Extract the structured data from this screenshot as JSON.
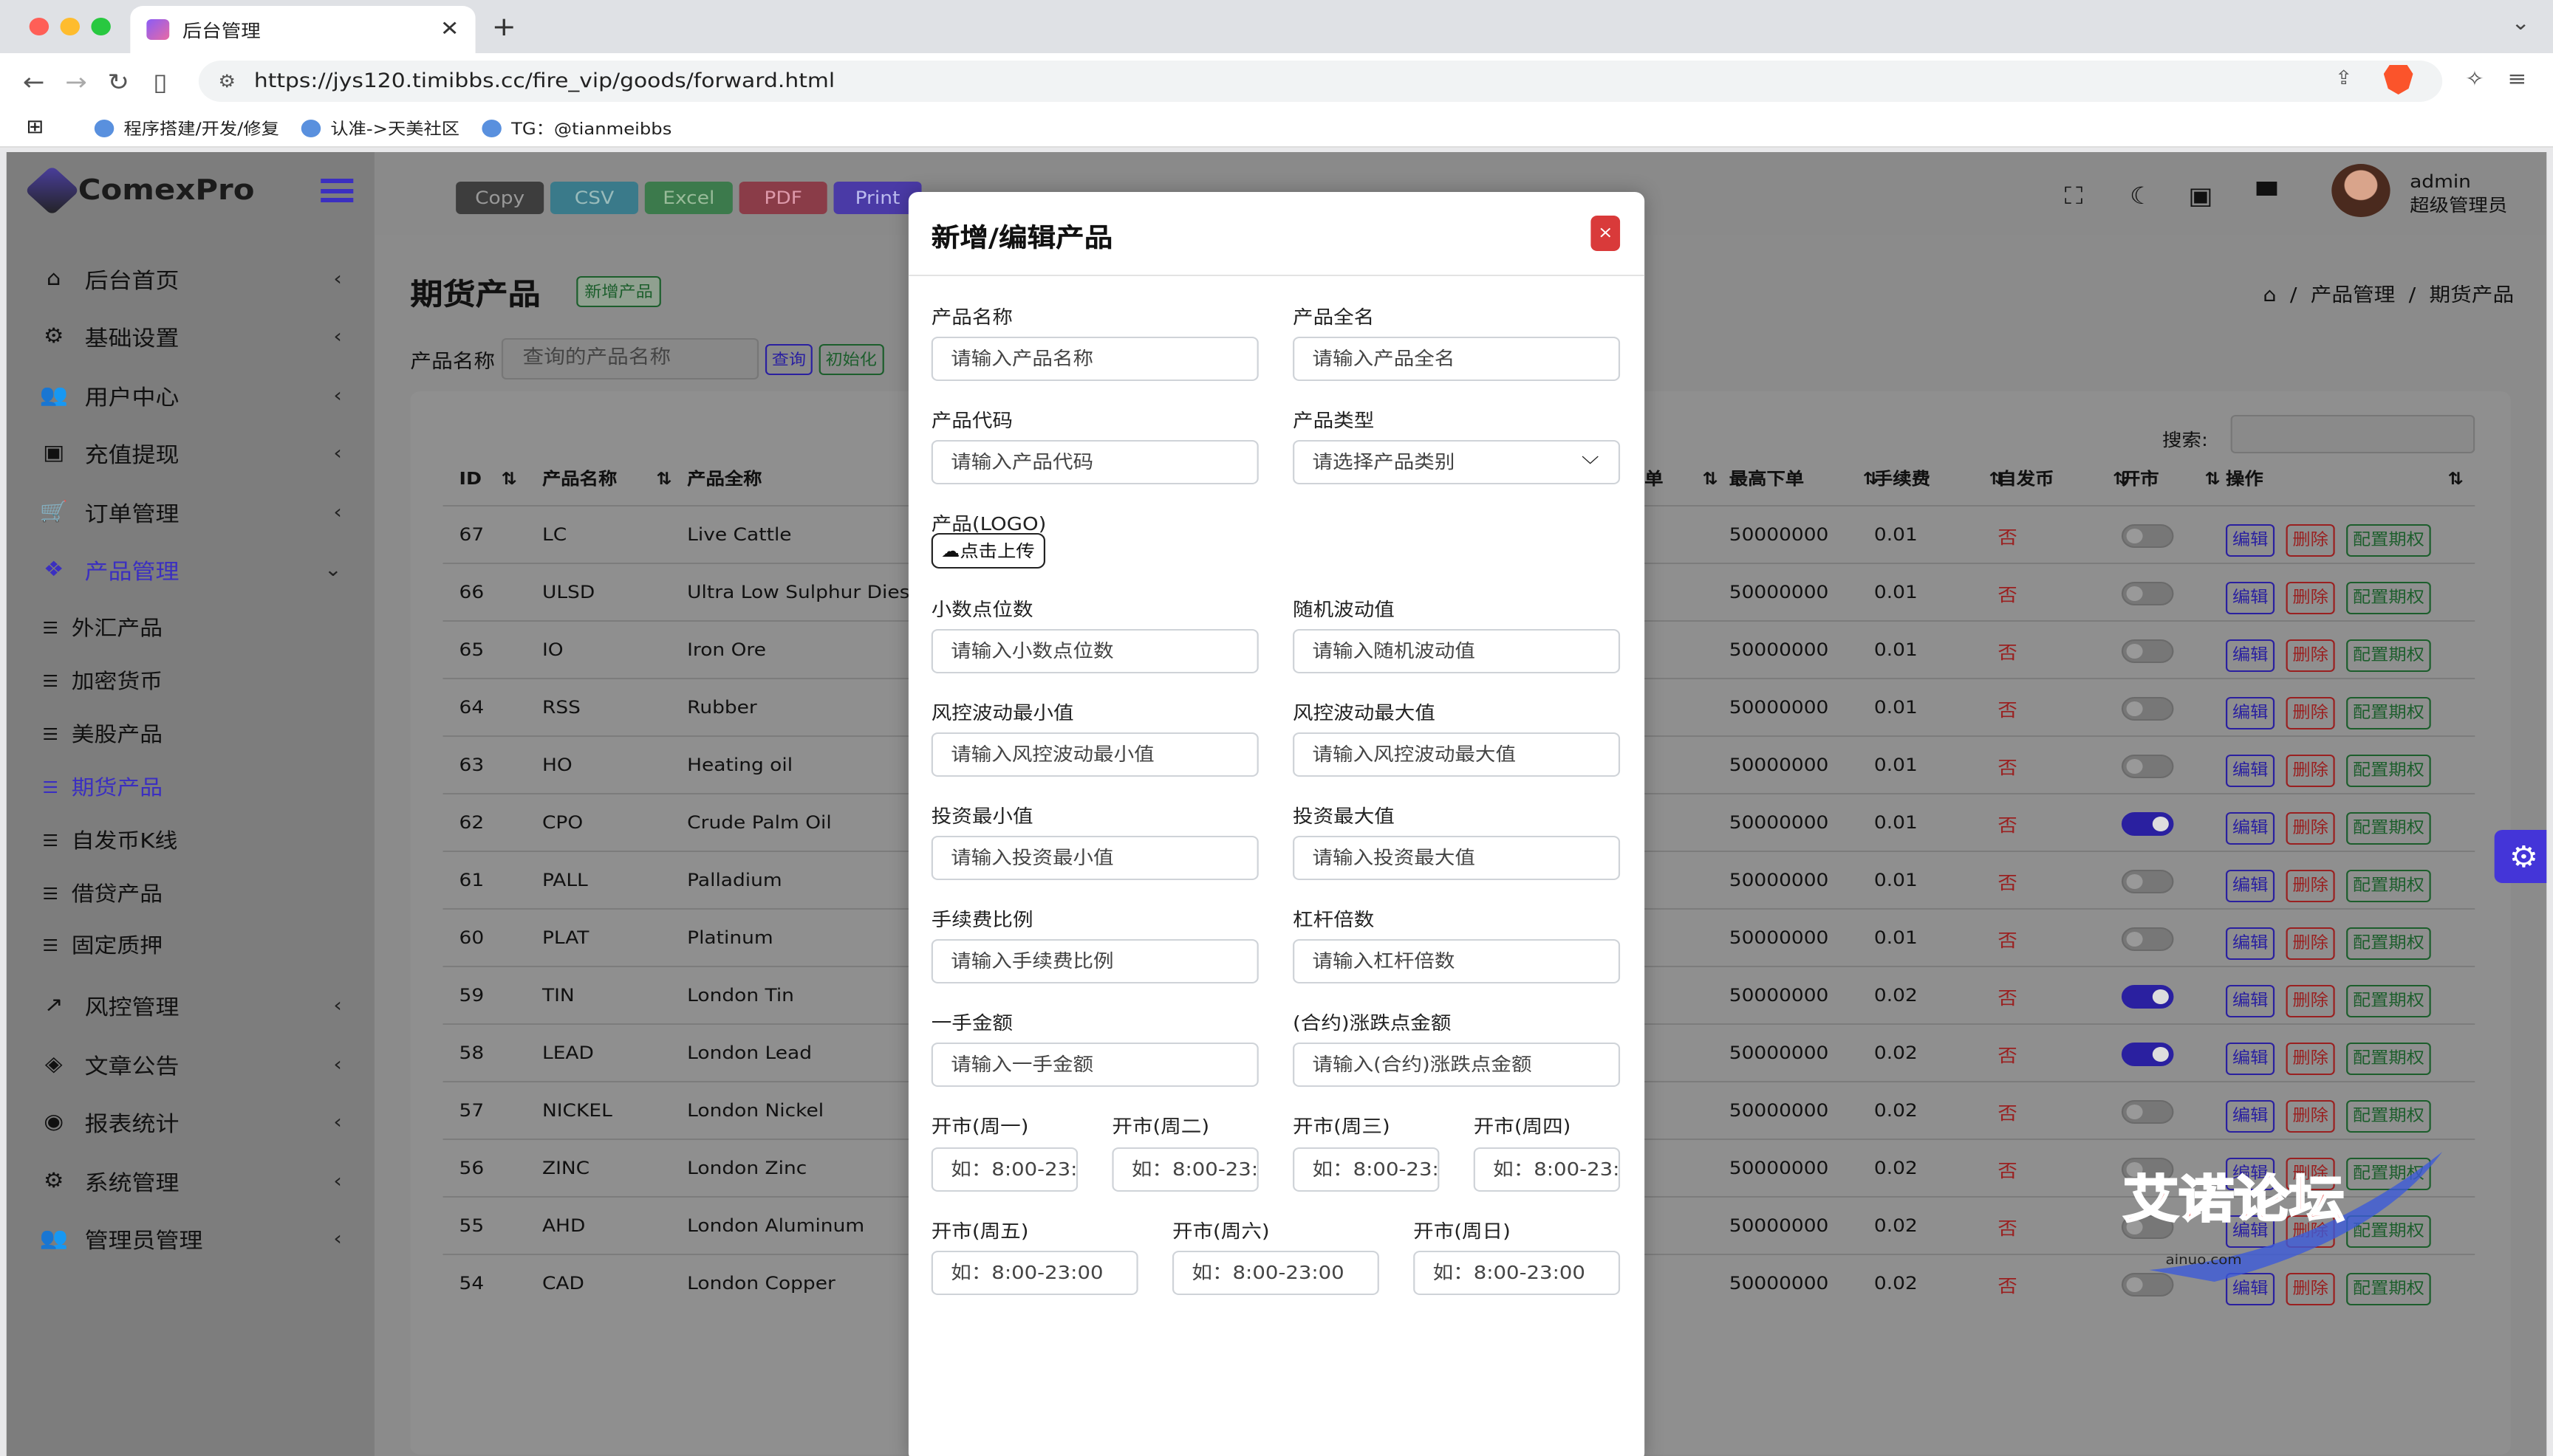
{
  "browser": {
    "tab_title": "后台管理",
    "url": "https://jys120.timibbs.cc/fire_vip/goods/forward.html",
    "bookmarks": [
      "程序搭建/开发/修复",
      "认准->天美社区",
      "TG：@tianmeibbs"
    ]
  },
  "app": {
    "logo": "ComexPro",
    "user": {
      "name": "admin",
      "role": "超级管理员"
    },
    "menu": [
      {
        "label": "后台首页",
        "icon": "home-icon"
      },
      {
        "label": "基础设置",
        "icon": "gears-icon"
      },
      {
        "label": "用户中心",
        "icon": "users-icon"
      },
      {
        "label": "充值提现",
        "icon": "money-icon"
      },
      {
        "label": "订单管理",
        "icon": "cart-icon"
      },
      {
        "label": "产品管理",
        "icon": "cubes-icon"
      },
      {
        "label": "风控管理",
        "icon": "chart-line-icon"
      },
      {
        "label": "文章公告",
        "icon": "layers-icon"
      },
      {
        "label": "报表统计",
        "icon": "coins-icon"
      },
      {
        "label": "系统管理",
        "icon": "gear-icon"
      },
      {
        "label": "管理员管理",
        "icon": "users-cog-icon"
      }
    ],
    "submenu": [
      "外汇产品",
      "加密货币",
      "美股产品",
      "期货产品",
      "自发币K线",
      "借贷产品",
      "固定质押"
    ],
    "active_menu": "产品管理",
    "active_submenu": "期货产品"
  },
  "page": {
    "title": "期货产品",
    "add_button": "新增产品",
    "breadcrumb": {
      "level1": "产品管理",
      "level2": "期货产品"
    },
    "search": {
      "label": "产品名称",
      "placeholder": "查询的产品名称",
      "query_btn": "查询",
      "reset_btn": "初始化"
    },
    "export_buttons": [
      "Copy",
      "CSV",
      "Excel",
      "PDF",
      "Print"
    ],
    "table_search_label": "搜索:"
  },
  "table": {
    "headers": {
      "id": "ID",
      "name": "产品名称",
      "fullname": "产品全称",
      "min_order_fragment": "单",
      "max_order": "最高下单",
      "fee": "手续费",
      "self_coin": "自发币",
      "open": "开市",
      "actions": "操作"
    },
    "action_labels": {
      "edit": "编辑",
      "delete": "删除",
      "options": "配置期权"
    },
    "rows": [
      {
        "id": "67",
        "name": "LC",
        "fullname": "Live Cattle",
        "max": "50000000",
        "fee": "0.01",
        "self": "否",
        "open": false
      },
      {
        "id": "66",
        "name": "ULSD",
        "fullname": "Ultra Low Sulphur Diesel",
        "max": "50000000",
        "fee": "0.01",
        "self": "否",
        "open": false
      },
      {
        "id": "65",
        "name": "IO",
        "fullname": "Iron Ore",
        "max": "50000000",
        "fee": "0.01",
        "self": "否",
        "open": false
      },
      {
        "id": "64",
        "name": "RSS",
        "fullname": "Rubber",
        "max": "50000000",
        "fee": "0.01",
        "self": "否",
        "open": false
      },
      {
        "id": "63",
        "name": "HO",
        "fullname": "Heating oil",
        "max": "50000000",
        "fee": "0.01",
        "self": "否",
        "open": false
      },
      {
        "id": "62",
        "name": "CPO",
        "fullname": "Crude Palm Oil",
        "max": "50000000",
        "fee": "0.01",
        "self": "否",
        "open": true
      },
      {
        "id": "61",
        "name": "PALL",
        "fullname": "Palladium",
        "max": "50000000",
        "fee": "0.01",
        "self": "否",
        "open": false
      },
      {
        "id": "60",
        "name": "PLAT",
        "fullname": "Platinum",
        "max": "50000000",
        "fee": "0.01",
        "self": "否",
        "open": false
      },
      {
        "id": "59",
        "name": "TIN",
        "fullname": "London Tin",
        "max": "50000000",
        "fee": "0.02",
        "self": "否",
        "open": true
      },
      {
        "id": "58",
        "name": "LEAD",
        "fullname": "London Lead",
        "max": "50000000",
        "fee": "0.02",
        "self": "否",
        "open": true
      },
      {
        "id": "57",
        "name": "NICKEL",
        "fullname": "London Nickel",
        "max": "50000000",
        "fee": "0.02",
        "self": "否",
        "open": false
      },
      {
        "id": "56",
        "name": "ZINC",
        "fullname": "London Zinc",
        "max": "50000000",
        "fee": "0.02",
        "self": "否",
        "open": false
      },
      {
        "id": "55",
        "name": "AHD",
        "fullname": "London Aluminum",
        "max": "50000000",
        "fee": "0.02",
        "self": "否",
        "open": false
      },
      {
        "id": "54",
        "name": "CAD",
        "fullname": "London Copper",
        "max": "50000000",
        "fee": "0.02",
        "self": "否",
        "open": false
      }
    ]
  },
  "modal": {
    "title": "新增/编辑产品",
    "close": "×",
    "upload": {
      "label": "产品(LOGO)",
      "button": "点击上传"
    },
    "fields": [
      {
        "label": "产品名称",
        "placeholder": "请输入产品名称"
      },
      {
        "label": "产品全名",
        "placeholder": "请输入产品全名"
      },
      {
        "label": "产品代码",
        "placeholder": "请输入产品代码"
      },
      {
        "label": "产品类型",
        "placeholder": "请选择产品类别"
      },
      {
        "label": "小数点位数",
        "placeholder": "请输入小数点位数"
      },
      {
        "label": "随机波动值",
        "placeholder": "请输入随机波动值"
      },
      {
        "label": "风控波动最小值",
        "placeholder": "请输入风控波动最小值"
      },
      {
        "label": "风控波动最大值",
        "placeholder": "请输入风控波动最大值"
      },
      {
        "label": "投资最小值",
        "placeholder": "请输入投资最小值"
      },
      {
        "label": "投资最大值",
        "placeholder": "请输入投资最大值"
      },
      {
        "label": "手续费比例",
        "placeholder": "请输入手续费比例"
      },
      {
        "label": "杠杆倍数",
        "placeholder": "请输入杠杆倍数"
      },
      {
        "label": "一手金额",
        "placeholder": "请输入一手金额"
      },
      {
        "label": "(合约)涨跌点金额",
        "placeholder": "请输入(合约)涨跌点金额"
      }
    ],
    "weekday_fields": [
      {
        "label": "开市(周一)",
        "placeholder": "如：8:00-23:"
      },
      {
        "label": "开市(周二)",
        "placeholder": "如：8:00-23:"
      },
      {
        "label": "开市(周三)",
        "placeholder": "如：8:00-23:"
      },
      {
        "label": "开市(周四)",
        "placeholder": "如：8:00-23:"
      },
      {
        "label": "开市(周五)",
        "placeholder": "如：8:00-23:00"
      },
      {
        "label": "开市(周六)",
        "placeholder": "如：8:00-23:00"
      },
      {
        "label": "开市(周日)",
        "placeholder": "如：8:00-23:00"
      }
    ]
  },
  "watermark": {
    "text": "艾诺论坛",
    "sub": "ainuo.com"
  },
  "colors": {
    "accent": "#3b2fc0",
    "danger": "#d93a3a",
    "success": "#1c5e2c"
  }
}
